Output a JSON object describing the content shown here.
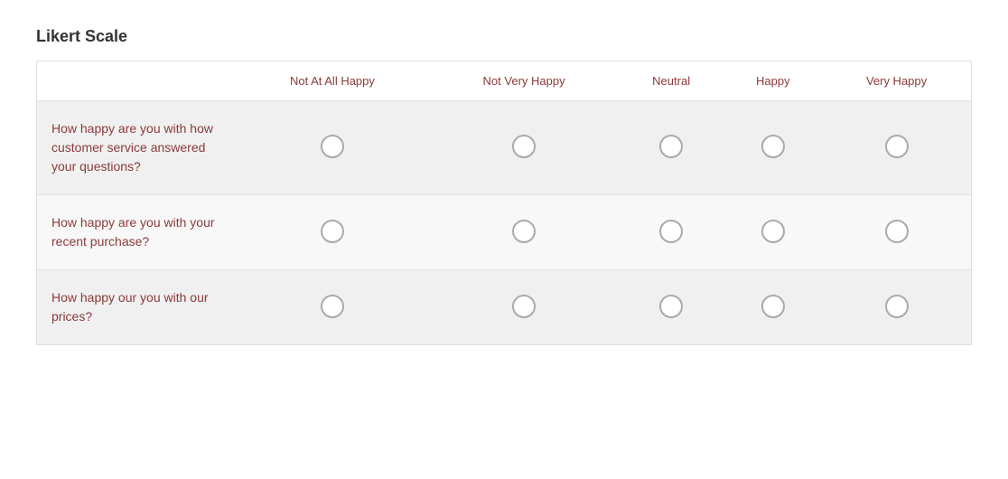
{
  "title": "Likert Scale",
  "columns": {
    "question": "",
    "col1": "Not At All Happy",
    "col2": "Not Very Happy",
    "col3": "Neutral",
    "col4": "Happy",
    "col5": "Very Happy"
  },
  "rows": [
    {
      "question": "How happy are you with how customer service answered your questions?",
      "values": [
        null,
        null,
        null,
        null,
        null
      ]
    },
    {
      "question": "How happy are you with your recent purchase?",
      "values": [
        null,
        null,
        null,
        null,
        null
      ]
    },
    {
      "question": "How happy our you with our prices?",
      "values": [
        null,
        null,
        null,
        null,
        null
      ]
    }
  ]
}
